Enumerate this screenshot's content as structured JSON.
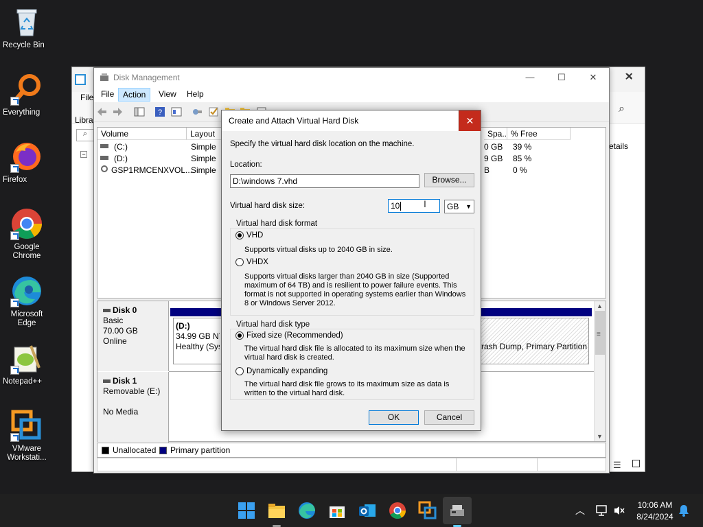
{
  "desktop": {
    "icons": [
      {
        "label": "Recycle Bin"
      },
      {
        "label": "Everything"
      },
      {
        "label": "Firefox"
      },
      {
        "label": "Google Chrome"
      },
      {
        "label": "Microsoft Edge"
      },
      {
        "label": "Notepad++"
      },
      {
        "label": "VMware Workstati..."
      }
    ]
  },
  "bg_window": {
    "file_menu": "File",
    "libra_text": "Libra",
    "details_text": "etails"
  },
  "disk_mgmt": {
    "title": "Disk Management",
    "menus": [
      "File",
      "Action",
      "View",
      "Help"
    ],
    "columns": {
      "volume": "Volume",
      "layout": "Layout",
      "space": "Spa...",
      "pct_free": "% Free"
    },
    "volumes": [
      {
        "name": "(C:)",
        "layout": "Simple",
        "space": "0 GB",
        "pct": "39 %"
      },
      {
        "name": "(D:)",
        "layout": "Simple",
        "space": "9 GB",
        "pct": "85 %"
      },
      {
        "name": "GSP1RMCENXVOL...",
        "layout": "Simple",
        "space": "B",
        "pct": "0 %"
      }
    ],
    "disk0": {
      "name": "Disk 0",
      "type": "Basic",
      "size": "70.00 GB",
      "status": "Online",
      "partition_name": "(D:)",
      "partition_size": "34.99 GB NT",
      "partition_status": "Healthy (Syst",
      "right_partition_status": "rash Dump, Primary Partition"
    },
    "disk1": {
      "name": "Disk 1",
      "type": "Removable (E:)",
      "status": "No Media"
    },
    "legend": {
      "unallocated": "Unallocated",
      "primary": "Primary partition"
    },
    "colors": {
      "primary_partition": "#000080",
      "unallocated": "#000000"
    }
  },
  "dialog": {
    "title": "Create and Attach Virtual Hard Disk",
    "intro": "Specify the virtual hard disk location on the machine.",
    "location_label": "Location:",
    "location_value": "D:\\windows 7.vhd",
    "browse_label": "Browse...",
    "size_label": "Virtual hard disk size:",
    "size_value": "10",
    "size_unit": "GB",
    "format_group": "Virtual hard disk format",
    "vhd_label": "VHD",
    "vhd_desc": "Supports virtual disks up to 2040 GB in size.",
    "vhdx_label": "VHDX",
    "vhdx_desc": "Supports virtual disks larger than 2040 GB in size (Supported maximum of 64 TB) and is resilient to power failure events. This format is not supported in operating systems earlier than Windows 8 or Windows Server 2012.",
    "type_group": "Virtual hard disk type",
    "fixed_label": "Fixed size (Recommended)",
    "fixed_desc": "The virtual hard disk file is allocated to its maximum size when the virtual hard disk is created.",
    "dynamic_label": "Dynamically expanding",
    "dynamic_desc": "The virtual hard disk file grows to its maximum size as data is written to the virtual hard disk.",
    "ok_label": "OK",
    "cancel_label": "Cancel",
    "selected_format": "VHD",
    "selected_type": "Fixed size (Recommended)"
  },
  "taskbar": {
    "time": "10:06 AM",
    "date": "8/24/2024",
    "accent": "#0078d4"
  }
}
